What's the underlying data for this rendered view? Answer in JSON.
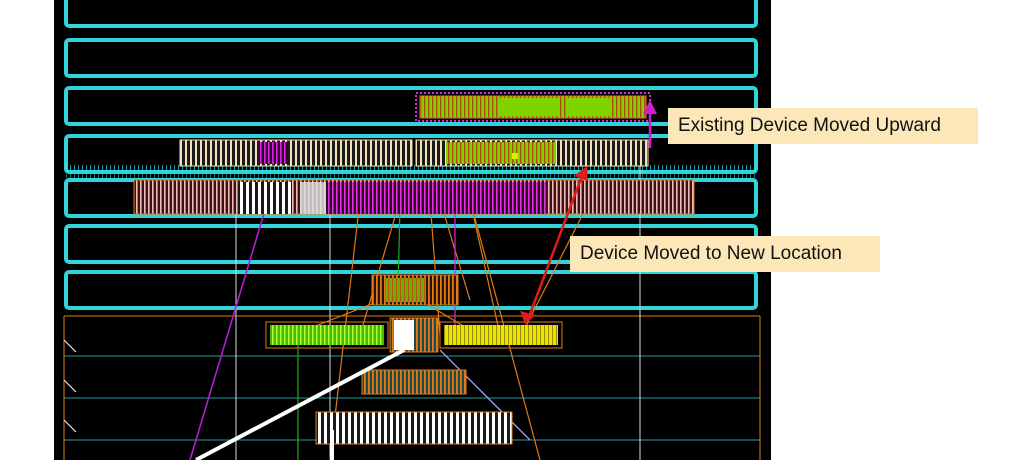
{
  "annotations": {
    "existing_device_moved_upward": "Existing Device Moved Upward",
    "device_moved_to_new_location": "Device Moved to New Location"
  },
  "colors": {
    "background": "#000000",
    "page": "#ffffff",
    "cyan_rows": "#33e0e6",
    "device_green": "#7fd400",
    "device_orange_outline": "#e07a1a",
    "device_yellow": "#f2f200",
    "device_beige": "#f3e2b9",
    "device_magenta": "#e021e0",
    "arrow_red": "#e01b1b",
    "arrow_magenta": "#d21cd2",
    "wire_white": "#ffffff",
    "callout_bg": "#fbe7b8"
  }
}
